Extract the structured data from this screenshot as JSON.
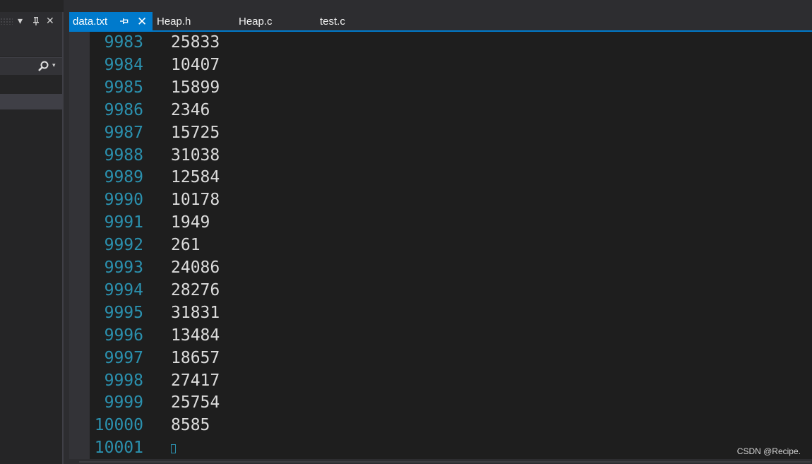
{
  "left_panel": {
    "dropdown_glyph": "▾",
    "pin_glyph": "⊥",
    "close_glyph": "✕",
    "search_dropdown_glyph": "▾"
  },
  "tabs": [
    {
      "label": "data.txt",
      "active": true,
      "pin_glyph": "⊣",
      "close_glyph": "✕"
    },
    {
      "label": "Heap.h",
      "active": false
    },
    {
      "label": "Heap.c",
      "active": false
    },
    {
      "label": "test.c",
      "active": false
    }
  ],
  "editor": {
    "lines": [
      {
        "num": "9983",
        "text": "25833"
      },
      {
        "num": "9984",
        "text": "10407"
      },
      {
        "num": "9985",
        "text": "15899"
      },
      {
        "num": "9986",
        "text": "2346"
      },
      {
        "num": "9987",
        "text": "15725"
      },
      {
        "num": "9988",
        "text": "31038"
      },
      {
        "num": "9989",
        "text": "12584"
      },
      {
        "num": "9990",
        "text": "10178"
      },
      {
        "num": "9991",
        "text": "1949"
      },
      {
        "num": "9992",
        "text": "261"
      },
      {
        "num": "9993",
        "text": "24086"
      },
      {
        "num": "9994",
        "text": "28276"
      },
      {
        "num": "9995",
        "text": "31831"
      },
      {
        "num": "9996",
        "text": "13484"
      },
      {
        "num": "9997",
        "text": "18657"
      },
      {
        "num": "9998",
        "text": "27417"
      },
      {
        "num": "9999",
        "text": "25754"
      },
      {
        "num": "10000",
        "text": "8585"
      },
      {
        "num": "10001",
        "text": ""
      }
    ]
  },
  "watermark": "CSDN @Recipe.",
  "colors": {
    "accent": "#007acc",
    "line_number": "#2b91af",
    "text": "#dcdcdc",
    "editor_bg": "#1e1e1e"
  }
}
